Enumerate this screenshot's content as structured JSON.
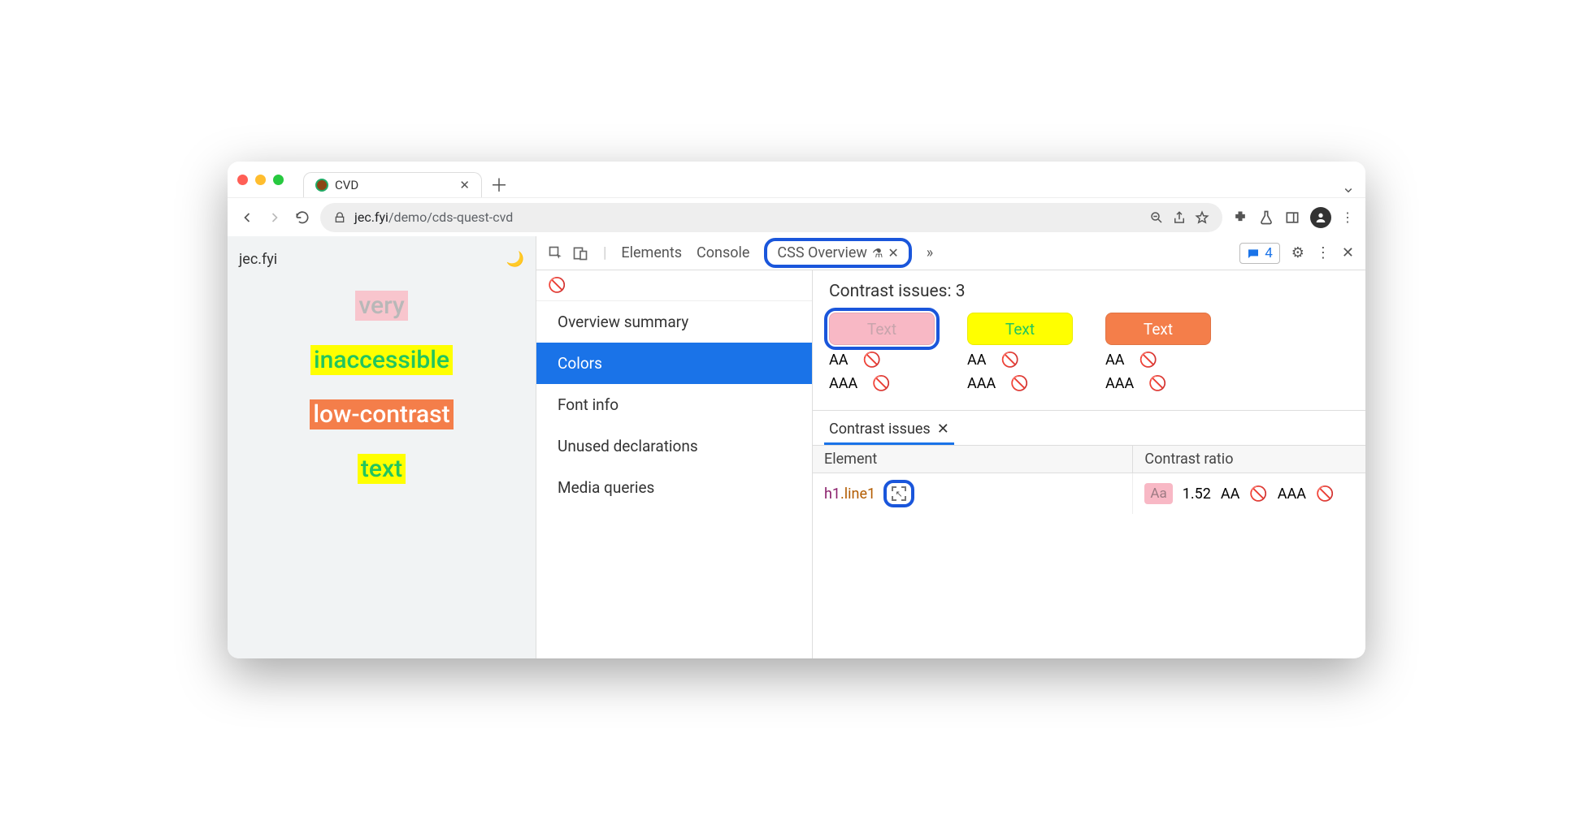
{
  "browser": {
    "tab_title": "CVD",
    "url_host": "jec.fyi",
    "url_path": "/demo/cds-quest-cvd"
  },
  "page": {
    "brand": "jec.fyi",
    "words": [
      "very",
      "inaccessible",
      "low-contrast",
      "text"
    ]
  },
  "devtools": {
    "tabs": {
      "elements": "Elements",
      "console": "Console",
      "css_overview": "CSS Overview"
    },
    "issues_count": "4",
    "sidebar": [
      "Overview summary",
      "Colors",
      "Font info",
      "Unused declarations",
      "Media queries"
    ],
    "sidebar_active_index": 1,
    "contrast": {
      "heading": "Contrast issues: 3",
      "swatch_label": "Text",
      "aa_label": "AA",
      "aaa_label": "AAA"
    },
    "issues_panel": {
      "tab_label": "Contrast issues",
      "col_element": "Element",
      "col_ratio": "Contrast ratio",
      "row1": {
        "tag": "h1",
        "cls": ".line1",
        "chip": "Aa",
        "ratio": "1.52",
        "aa": "AA",
        "aaa": "AAA"
      }
    }
  }
}
